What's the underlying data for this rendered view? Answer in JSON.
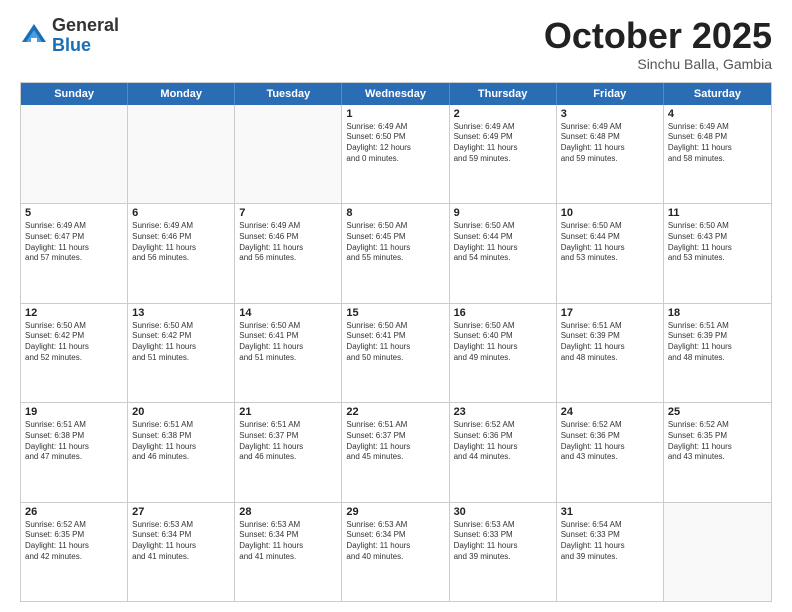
{
  "logo": {
    "general": "General",
    "blue": "Blue"
  },
  "header": {
    "month": "October 2025",
    "location": "Sinchu Balla, Gambia"
  },
  "days": [
    "Sunday",
    "Monday",
    "Tuesday",
    "Wednesday",
    "Thursday",
    "Friday",
    "Saturday"
  ],
  "weeks": [
    [
      {
        "day": "",
        "lines": []
      },
      {
        "day": "",
        "lines": []
      },
      {
        "day": "",
        "lines": []
      },
      {
        "day": "1",
        "lines": [
          "Sunrise: 6:49 AM",
          "Sunset: 6:50 PM",
          "Daylight: 12 hours",
          "and 0 minutes."
        ]
      },
      {
        "day": "2",
        "lines": [
          "Sunrise: 6:49 AM",
          "Sunset: 6:49 PM",
          "Daylight: 11 hours",
          "and 59 minutes."
        ]
      },
      {
        "day": "3",
        "lines": [
          "Sunrise: 6:49 AM",
          "Sunset: 6:48 PM",
          "Daylight: 11 hours",
          "and 59 minutes."
        ]
      },
      {
        "day": "4",
        "lines": [
          "Sunrise: 6:49 AM",
          "Sunset: 6:48 PM",
          "Daylight: 11 hours",
          "and 58 minutes."
        ]
      }
    ],
    [
      {
        "day": "5",
        "lines": [
          "Sunrise: 6:49 AM",
          "Sunset: 6:47 PM",
          "Daylight: 11 hours",
          "and 57 minutes."
        ]
      },
      {
        "day": "6",
        "lines": [
          "Sunrise: 6:49 AM",
          "Sunset: 6:46 PM",
          "Daylight: 11 hours",
          "and 56 minutes."
        ]
      },
      {
        "day": "7",
        "lines": [
          "Sunrise: 6:49 AM",
          "Sunset: 6:46 PM",
          "Daylight: 11 hours",
          "and 56 minutes."
        ]
      },
      {
        "day": "8",
        "lines": [
          "Sunrise: 6:50 AM",
          "Sunset: 6:45 PM",
          "Daylight: 11 hours",
          "and 55 minutes."
        ]
      },
      {
        "day": "9",
        "lines": [
          "Sunrise: 6:50 AM",
          "Sunset: 6:44 PM",
          "Daylight: 11 hours",
          "and 54 minutes."
        ]
      },
      {
        "day": "10",
        "lines": [
          "Sunrise: 6:50 AM",
          "Sunset: 6:44 PM",
          "Daylight: 11 hours",
          "and 53 minutes."
        ]
      },
      {
        "day": "11",
        "lines": [
          "Sunrise: 6:50 AM",
          "Sunset: 6:43 PM",
          "Daylight: 11 hours",
          "and 53 minutes."
        ]
      }
    ],
    [
      {
        "day": "12",
        "lines": [
          "Sunrise: 6:50 AM",
          "Sunset: 6:42 PM",
          "Daylight: 11 hours",
          "and 52 minutes."
        ]
      },
      {
        "day": "13",
        "lines": [
          "Sunrise: 6:50 AM",
          "Sunset: 6:42 PM",
          "Daylight: 11 hours",
          "and 51 minutes."
        ]
      },
      {
        "day": "14",
        "lines": [
          "Sunrise: 6:50 AM",
          "Sunset: 6:41 PM",
          "Daylight: 11 hours",
          "and 51 minutes."
        ]
      },
      {
        "day": "15",
        "lines": [
          "Sunrise: 6:50 AM",
          "Sunset: 6:41 PM",
          "Daylight: 11 hours",
          "and 50 minutes."
        ]
      },
      {
        "day": "16",
        "lines": [
          "Sunrise: 6:50 AM",
          "Sunset: 6:40 PM",
          "Daylight: 11 hours",
          "and 49 minutes."
        ]
      },
      {
        "day": "17",
        "lines": [
          "Sunrise: 6:51 AM",
          "Sunset: 6:39 PM",
          "Daylight: 11 hours",
          "and 48 minutes."
        ]
      },
      {
        "day": "18",
        "lines": [
          "Sunrise: 6:51 AM",
          "Sunset: 6:39 PM",
          "Daylight: 11 hours",
          "and 48 minutes."
        ]
      }
    ],
    [
      {
        "day": "19",
        "lines": [
          "Sunrise: 6:51 AM",
          "Sunset: 6:38 PM",
          "Daylight: 11 hours",
          "and 47 minutes."
        ]
      },
      {
        "day": "20",
        "lines": [
          "Sunrise: 6:51 AM",
          "Sunset: 6:38 PM",
          "Daylight: 11 hours",
          "and 46 minutes."
        ]
      },
      {
        "day": "21",
        "lines": [
          "Sunrise: 6:51 AM",
          "Sunset: 6:37 PM",
          "Daylight: 11 hours",
          "and 46 minutes."
        ]
      },
      {
        "day": "22",
        "lines": [
          "Sunrise: 6:51 AM",
          "Sunset: 6:37 PM",
          "Daylight: 11 hours",
          "and 45 minutes."
        ]
      },
      {
        "day": "23",
        "lines": [
          "Sunrise: 6:52 AM",
          "Sunset: 6:36 PM",
          "Daylight: 11 hours",
          "and 44 minutes."
        ]
      },
      {
        "day": "24",
        "lines": [
          "Sunrise: 6:52 AM",
          "Sunset: 6:36 PM",
          "Daylight: 11 hours",
          "and 43 minutes."
        ]
      },
      {
        "day": "25",
        "lines": [
          "Sunrise: 6:52 AM",
          "Sunset: 6:35 PM",
          "Daylight: 11 hours",
          "and 43 minutes."
        ]
      }
    ],
    [
      {
        "day": "26",
        "lines": [
          "Sunrise: 6:52 AM",
          "Sunset: 6:35 PM",
          "Daylight: 11 hours",
          "and 42 minutes."
        ]
      },
      {
        "day": "27",
        "lines": [
          "Sunrise: 6:53 AM",
          "Sunset: 6:34 PM",
          "Daylight: 11 hours",
          "and 41 minutes."
        ]
      },
      {
        "day": "28",
        "lines": [
          "Sunrise: 6:53 AM",
          "Sunset: 6:34 PM",
          "Daylight: 11 hours",
          "and 41 minutes."
        ]
      },
      {
        "day": "29",
        "lines": [
          "Sunrise: 6:53 AM",
          "Sunset: 6:34 PM",
          "Daylight: 11 hours",
          "and 40 minutes."
        ]
      },
      {
        "day": "30",
        "lines": [
          "Sunrise: 6:53 AM",
          "Sunset: 6:33 PM",
          "Daylight: 11 hours",
          "and 39 minutes."
        ]
      },
      {
        "day": "31",
        "lines": [
          "Sunrise: 6:54 AM",
          "Sunset: 6:33 PM",
          "Daylight: 11 hours",
          "and 39 minutes."
        ]
      },
      {
        "day": "",
        "lines": []
      }
    ]
  ]
}
